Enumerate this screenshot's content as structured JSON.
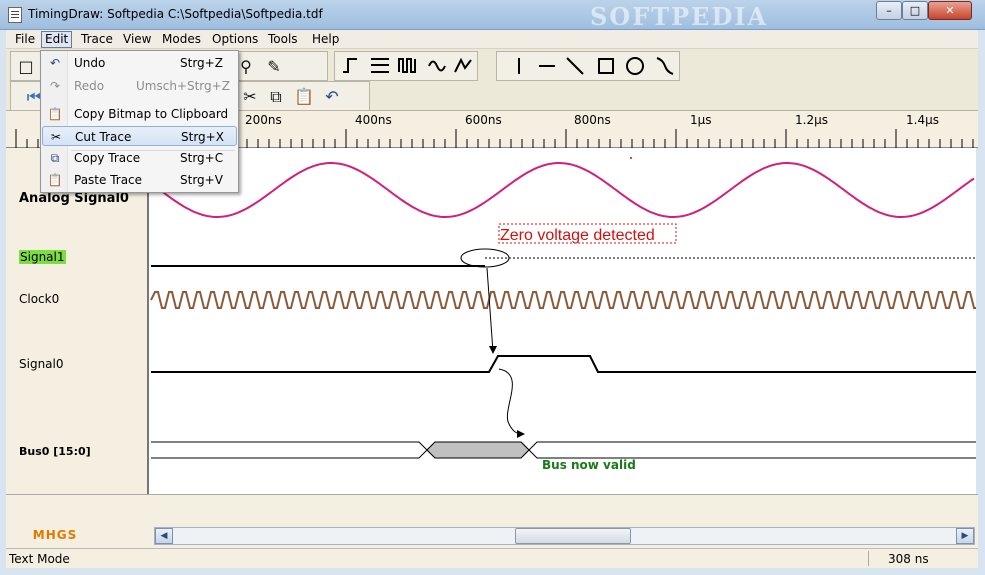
{
  "window": {
    "title": "TimingDraw: Softpedia  C:\\Softpedia\\Softpedia.tdf",
    "watermark": "SOFTPEDIA"
  },
  "window_buttons": {
    "minimize": "–",
    "maximize": "□",
    "close": "✕"
  },
  "menu": {
    "file": "File",
    "edit": "Edit",
    "trace": "Trace",
    "view": "View",
    "modes": "Modes",
    "options": "Options",
    "tools": "Tools",
    "help": "Help"
  },
  "edit_menu": {
    "items": [
      {
        "label": "Undo",
        "shortcut": "Strg+Z",
        "icon": "undo-icon",
        "enabled": true
      },
      {
        "label": "Redo",
        "shortcut": "Umsch+Strg+Z",
        "icon": "redo-icon",
        "enabled": false
      },
      {
        "label": "Copy Bitmap to Clipboard",
        "shortcut": "",
        "icon": "clipboard-icon",
        "enabled": true
      },
      {
        "label": "Cut Trace",
        "shortcut": "Strg+X",
        "icon": "scissors-icon",
        "enabled": true,
        "highlighted": true
      },
      {
        "label": "Copy Trace",
        "shortcut": "Strg+C",
        "icon": "copy-icon",
        "enabled": true
      },
      {
        "label": "Paste Trace",
        "shortcut": "Strg+V",
        "icon": "paste-icon",
        "enabled": true
      }
    ]
  },
  "ruler": {
    "ticks": [
      "200ns",
      "400ns",
      "600ns",
      "800ns",
      "1µs",
      "1.2µs",
      "1.4µs"
    ]
  },
  "signals": [
    {
      "name": "Analog Signal0",
      "bold": true
    },
    {
      "name": "Signal1",
      "highlight": "#7ddc3e"
    },
    {
      "name": "Clock0"
    },
    {
      "name": "Signal0"
    },
    {
      "name": "Bus0 [15:0]",
      "bold": true
    }
  ],
  "annotations": {
    "zero_voltage": "Zero voltage detected",
    "bus_valid": "Bus now valid"
  },
  "colors": {
    "analog": "#d0207e",
    "clock": "#8b5a3a",
    "annotation_red": "#d21010",
    "annotation_green": "#1a7a1a",
    "bus_fill": "#c0c0c0"
  },
  "logo": "MHGS",
  "scrollbar": {
    "left_arrow": "◀",
    "right_arrow": "▶"
  },
  "status": {
    "mode": "Text Mode",
    "time": "308 ns"
  }
}
